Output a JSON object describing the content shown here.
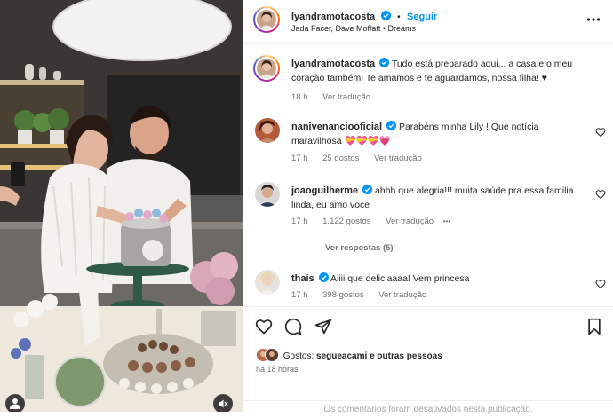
{
  "post": {
    "username": "lyandramotacosta",
    "follow_label": "Seguir",
    "separator": "•",
    "audio": "Jada Facer, Dave Moffatt • Dreams"
  },
  "caption": {
    "username": "lyandramotacosta",
    "text": "Tudo está preparado aqui... a casa e o meu coração também! Te amamos e te aguardamos, nossa filha! ♥",
    "time": "18 h",
    "translate": "Ver tradução"
  },
  "comments": [
    {
      "username": "nanivenanciooficial",
      "text": "Parabéns minha Lily ! Que notícia maravilhosa 💝💝💝💗",
      "time": "17 h",
      "likes": "25 gostos",
      "translate": "Ver tradução"
    },
    {
      "username": "joaoguilherme",
      "text": "ahhh que alegria!!! muita saúde pra essa familia linda, eu amo voce",
      "time": "17 h",
      "likes": "1.122 gostos",
      "translate": "Ver tradução",
      "more": "•••",
      "view_replies": "Ver respostas (5)"
    },
    {
      "username": "thais",
      "text": "Aiiii que deliciaaaa! Vem princesa",
      "time": "17 h",
      "likes": "398 gostos",
      "translate": "Ver tradução"
    }
  ],
  "footer": {
    "likes_prefix": "Gostos: ",
    "likes_user": "segueacami",
    "likes_suffix": " e outras pessoas",
    "time": "há 18 horas",
    "comments_disabled": "Os comentários foram desativados nesta publicação."
  },
  "icons": {
    "like": "heart-icon",
    "comment": "comment-icon",
    "share": "send-icon",
    "save": "bookmark-icon",
    "more": "more-icon",
    "verified": "verified-badge-icon",
    "mute": "speaker-muted-icon",
    "tagged": "user-tag-icon"
  },
  "colors": {
    "accent": "#0095f6",
    "verified": "#0095f6",
    "muted_text": "#737373",
    "border": "#efefef"
  }
}
